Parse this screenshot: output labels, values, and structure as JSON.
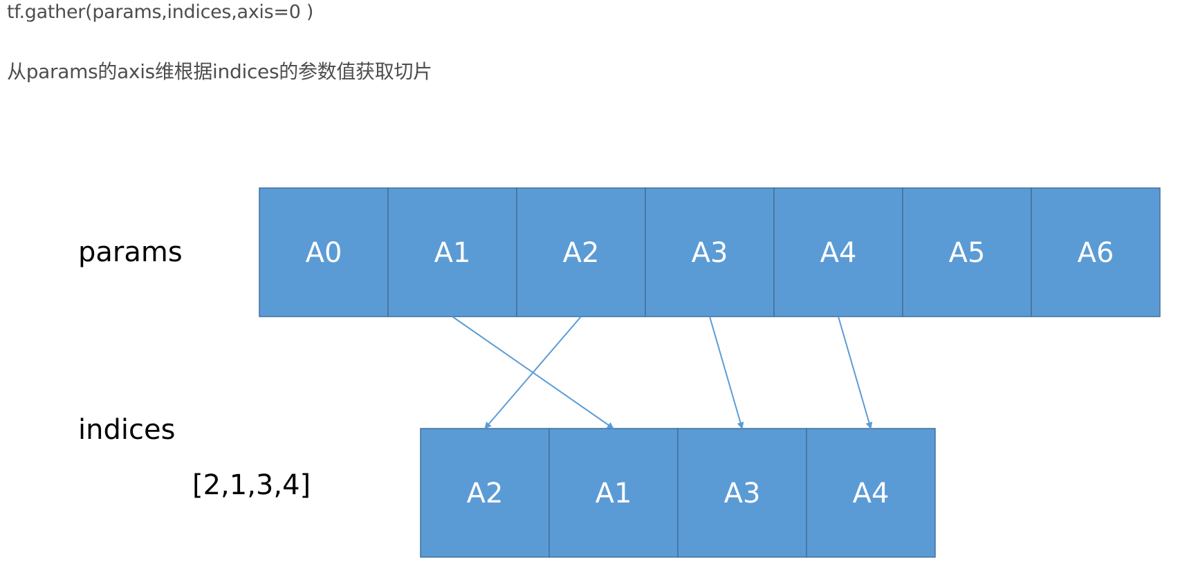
{
  "header": {
    "code": "tf.gather(params,indices,axis=0 )",
    "description": "从params的axis维根据indices的参数值获取切片"
  },
  "diagram": {
    "params_label": "params",
    "indices_label": "indices",
    "indices_value": "[2,1,3,4]",
    "params_cells": [
      "A0",
      "A1",
      "A2",
      "A3",
      "A4",
      "A5",
      "A6"
    ],
    "output_cells": [
      "A2",
      "A1",
      "A3",
      "A4"
    ],
    "indices": [
      2,
      1,
      3,
      4
    ],
    "colors": {
      "cell_fill": "#5b9bd5",
      "cell_stroke": "#41719c",
      "cell_text": "#ffffff",
      "arrow": "#5b9bd5",
      "label": "#000000"
    }
  }
}
